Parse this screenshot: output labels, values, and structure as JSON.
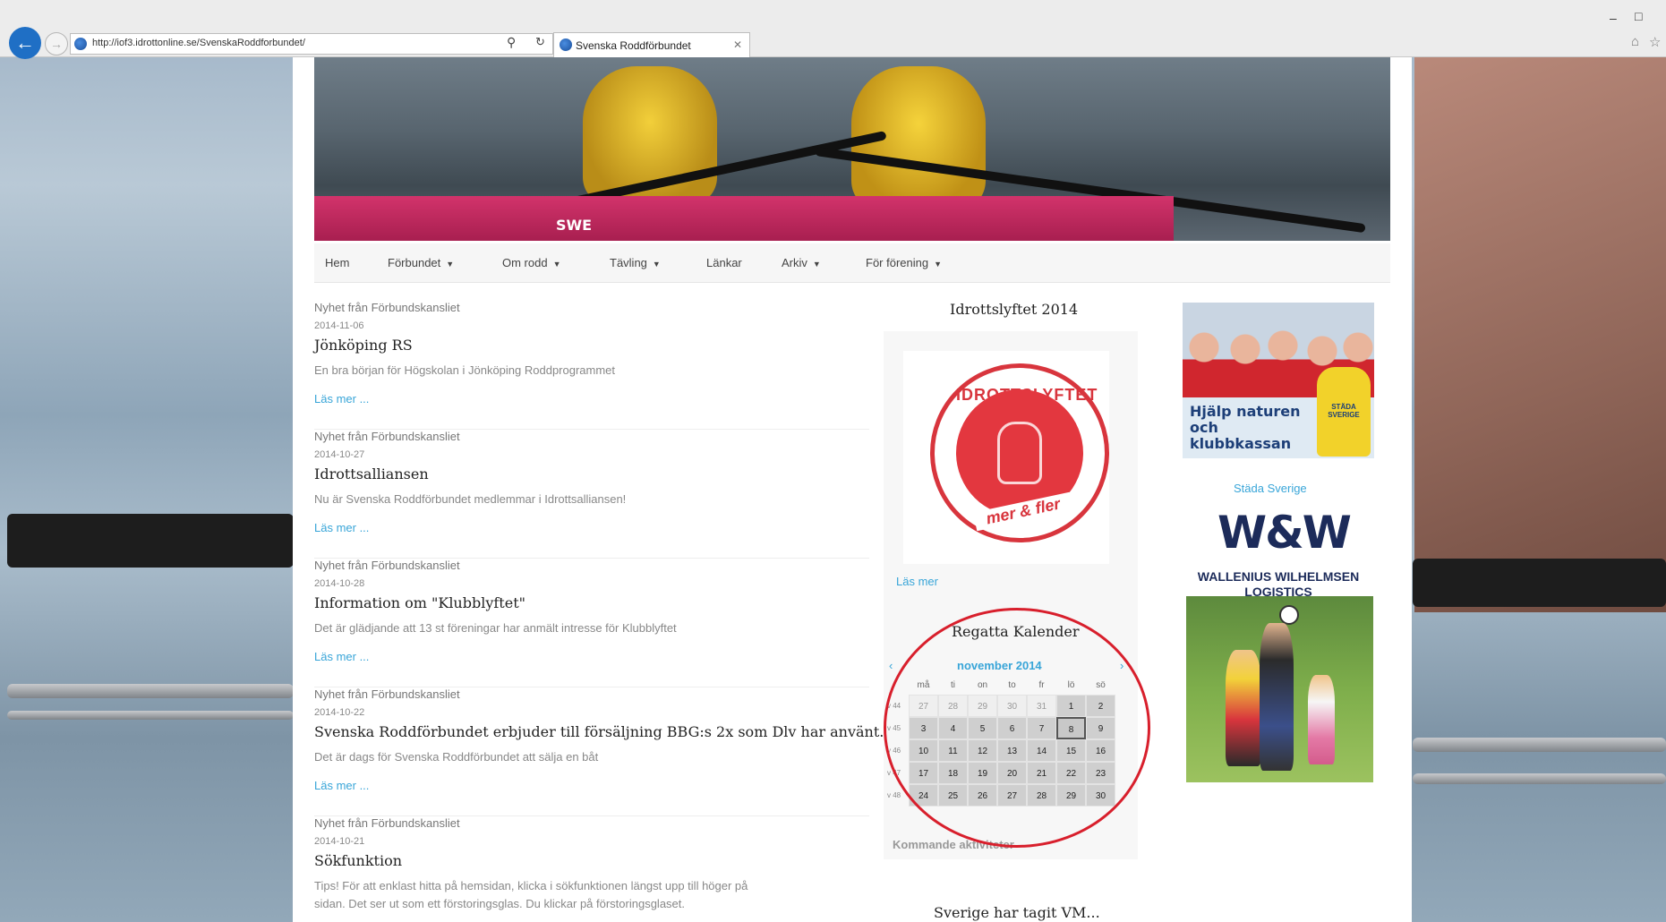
{
  "browser": {
    "url": "http://iof3.idrottonline.se/SvenskaRoddforbundet/",
    "tab_title": "Svenska Roddförbundet"
  },
  "hero": {
    "boat_label": "SWE"
  },
  "nav": {
    "items": [
      {
        "label": "Hem",
        "dropdown": false
      },
      {
        "label": "Förbundet",
        "dropdown": true
      },
      {
        "label": "Om rodd",
        "dropdown": true
      },
      {
        "label": "Tävling",
        "dropdown": true
      },
      {
        "label": "Länkar",
        "dropdown": false
      },
      {
        "label": "Arkiv",
        "dropdown": true
      },
      {
        "label": "För förening",
        "dropdown": true
      }
    ]
  },
  "news": [
    {
      "source": "Nyhet från Förbundskansliet",
      "date": "2014-11-06",
      "title": "Jönköping RS",
      "excerpt": "En bra början för Högskolan i Jönköping Roddprogrammet",
      "more": "Läs mer ..."
    },
    {
      "source": "Nyhet från Förbundskansliet",
      "date": "2014-10-27",
      "title": "Idrottsalliansen",
      "excerpt": "Nu är Svenska Roddförbundet medlemmar i Idrottsalliansen!",
      "more": "Läs mer ..."
    },
    {
      "source": "Nyhet från Förbundskansliet",
      "date": "2014-10-28",
      "title": "Information om \"Klubblyftet\"",
      "excerpt": "Det är glädjande att 13 st föreningar har anmält intresse för Klubblyftet",
      "more": "Läs mer ..."
    },
    {
      "source": "Nyhet från Förbundskansliet",
      "date": "2014-10-22",
      "title": "Svenska Roddförbundet erbjuder till försäljning BBG:s 2x som Dlv har använt.",
      "excerpt": "Det är dags för Svenska Roddförbundet att sälja en båt",
      "more": "Läs mer ..."
    },
    {
      "source": "Nyhet från Förbundskansliet",
      "date": "2014-10-21",
      "title": "Sökfunktion",
      "excerpt": "Tips! För att enklast hitta på hemsidan, klicka i sökfunktionen längst upp till höger på",
      "excerpt2": "sidan. Det ser ut som ett förstoringsglas. Du klickar på förstoringsglaset."
    }
  ],
  "widget_idrottslyftet": {
    "title": "Idrottslyftet 2014",
    "badge_top": "IDROTTSLYFTET",
    "badge_bottom": "mer & fler",
    "more": "Läs mer"
  },
  "calendar": {
    "title": "Regatta Kalender",
    "month": "november 2014",
    "prev": "‹",
    "next": "›",
    "day_headers": [
      "må",
      "ti",
      "on",
      "to",
      "fr",
      "lö",
      "sö"
    ],
    "weeks": [
      {
        "week": "v 44",
        "days": [
          "27",
          "28",
          "29",
          "30",
          "31",
          "1",
          "2"
        ]
      },
      {
        "week": "v 45",
        "days": [
          "3",
          "4",
          "5",
          "6",
          "7",
          "8",
          "9"
        ]
      },
      {
        "week": "v 46",
        "days": [
          "10",
          "11",
          "12",
          "13",
          "14",
          "15",
          "16"
        ]
      },
      {
        "week": "v 47",
        "days": [
          "17",
          "18",
          "19",
          "20",
          "21",
          "22",
          "23"
        ]
      },
      {
        "week": "v 48",
        "days": [
          "24",
          "25",
          "26",
          "27",
          "28",
          "29",
          "30"
        ]
      }
    ],
    "today": "8",
    "upcoming_label": "Kommande aktiviteter"
  },
  "widget_vm": {
    "title": "Sverige har tagit VM..."
  },
  "sponsors": {
    "stada_line1": "Hjälp naturen",
    "stada_line2": "och",
    "stada_line3": "klubbkassan",
    "stada_logo": "STÄDA SVERIGE",
    "stada_link": "Städa Sverige",
    "ww_logo": "W&W",
    "ww_text1": "WALLENIUS WILHELMSEN",
    "ww_text2": "LOGISTICS"
  },
  "colors": {
    "link": "#38a5d8",
    "annotation": "#d81f2c",
    "badge": "#d8353d"
  }
}
